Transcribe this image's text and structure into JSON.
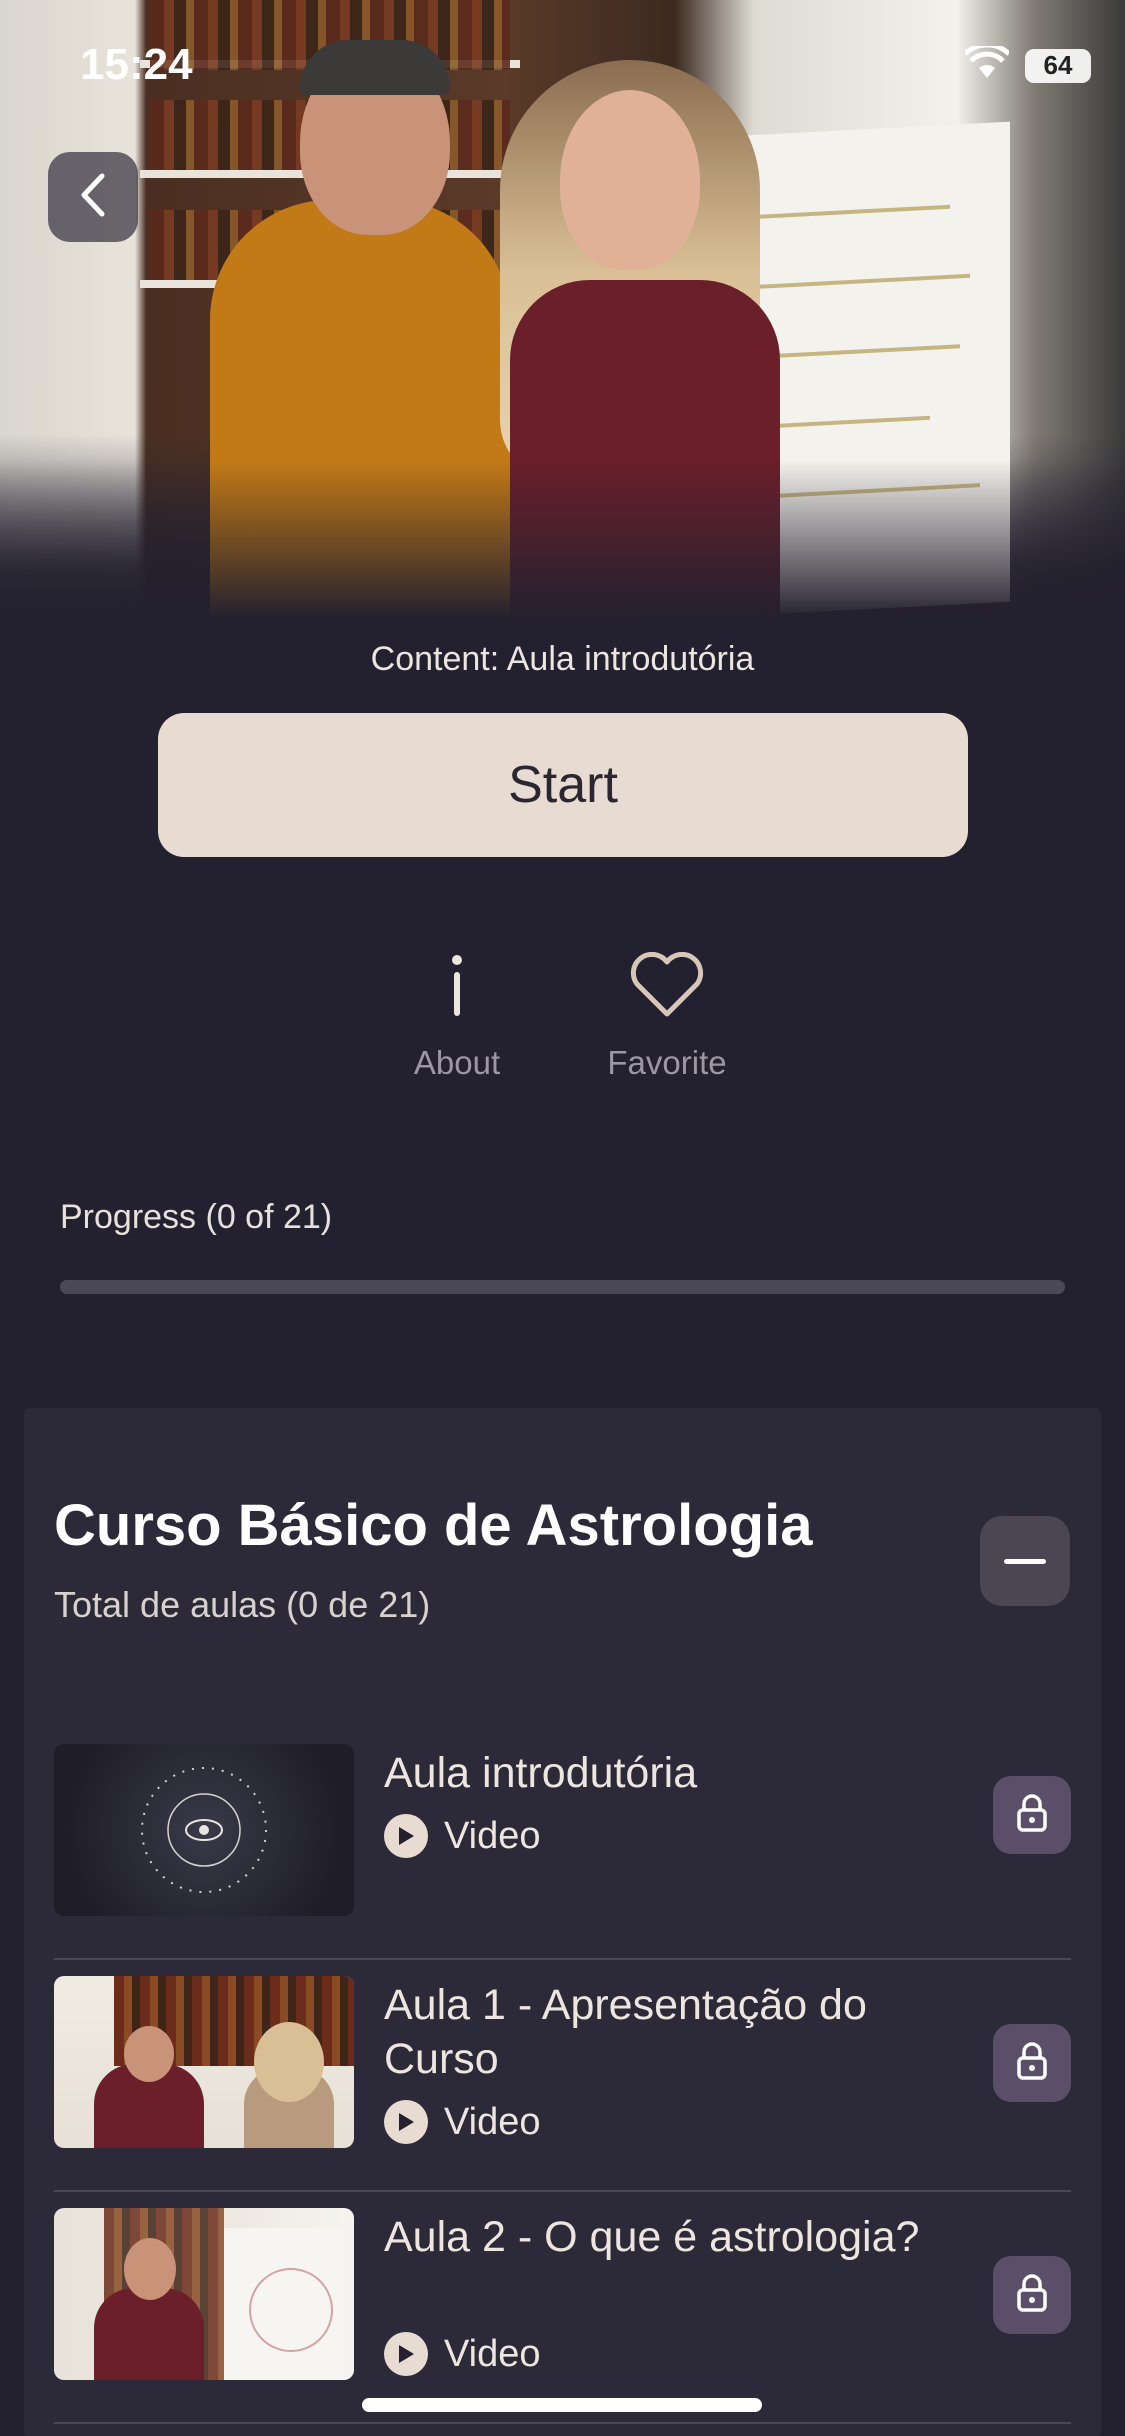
{
  "status_bar": {
    "time": "15:24",
    "battery": "64"
  },
  "hero": {
    "alt": "Instructors in front of bookshelf and astrology whiteboard"
  },
  "content_label": "Content: Aula introdutória",
  "start_button": "Start",
  "actions": {
    "about": "About",
    "favorite": "Favorite"
  },
  "progress": {
    "label": "Progress (0 of 21)",
    "completed": 0,
    "total": 21
  },
  "course": {
    "title": "Curso Básico de Astrologia",
    "subtitle": "Total de aulas (0 de 21)",
    "lessons": [
      {
        "title": "Aula introdutória",
        "type": "Video"
      },
      {
        "title": "Aula 1 - Apresentação do Curso",
        "type": "Video"
      },
      {
        "title": "Aula 2 - O que é astrologia?",
        "type": "Video"
      }
    ]
  },
  "colors": {
    "background": "#23202f",
    "panel": "#2c2938",
    "accent": "#e7dbd2",
    "lock": "#5a4e68"
  }
}
